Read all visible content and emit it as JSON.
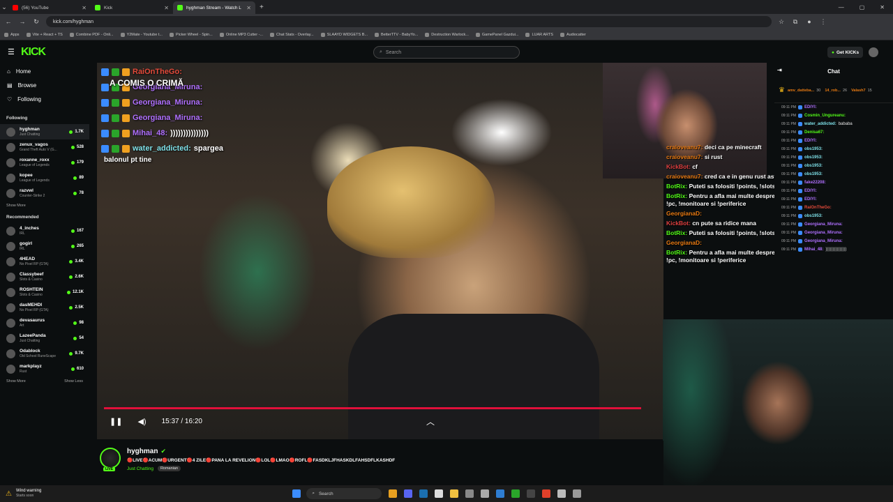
{
  "tabs": [
    {
      "title": "(56) YouTube",
      "icon": "youtube-icon",
      "color": "#ff0000",
      "active": false
    },
    {
      "title": "Kick",
      "icon": "kick-icon",
      "color": "#53fc18",
      "active": false
    },
    {
      "title": "hyghman Stream - Watch L",
      "icon": "kick-icon",
      "color": "#53fc18",
      "active": true
    }
  ],
  "address": "kick.com/hyghman",
  "bookmarks": [
    "Apps",
    "Vite + React + TS",
    "Combine PDF - Onli...",
    "Y2Mate - Youtube t...",
    "Picker Wheel - Spin...",
    "Online MP3 Cutter -...",
    "Chat Stats - Overlay...",
    "SLAAYD WIDGETS B...",
    "BetterTTV - BabyYo...",
    "Destruction Warlock...",
    "GamePanel Gazdui...",
    "LUAR ARTS",
    "Audiocatter"
  ],
  "header": {
    "logo": "KICK",
    "search_placeholder": "Search",
    "get_kicks": "Get KICKs"
  },
  "nav": {
    "home": "Home",
    "browse": "Browse",
    "following": "Following"
  },
  "sidebar": {
    "following_title": "Following",
    "following": [
      {
        "name": "hyghman",
        "category": "Just Chatting",
        "viewers": "1.7K"
      },
      {
        "name": "zenux_vagos",
        "category": "Grand Theft Auto V (G...",
        "viewers": "528"
      },
      {
        "name": "roxanne_roxx",
        "category": "League of Legends",
        "viewers": "179"
      },
      {
        "name": "kopee",
        "category": "League of Legends",
        "viewers": "89"
      },
      {
        "name": "razvwl",
        "category": "Counter-Strike 2",
        "viewers": "78"
      }
    ],
    "show_more": "Show More",
    "recommended_title": "Recommended",
    "recommended": [
      {
        "name": "4_inches",
        "category": "IRL",
        "viewers": "167"
      },
      {
        "name": "gogirl",
        "category": "IRL",
        "viewers": "265"
      },
      {
        "name": "4HEAD",
        "category": "No Pixel RP (GTA)",
        "viewers": "3.4K"
      },
      {
        "name": "Classybeef",
        "category": "Slots & Casino",
        "viewers": "2.6K"
      },
      {
        "name": "ROSHTEIN",
        "category": "Slots & Casino",
        "viewers": "12.1K"
      },
      {
        "name": "dasMEHDI",
        "category": "No Pixel RP (GTA)",
        "viewers": "2.5K"
      },
      {
        "name": "devasaurus",
        "category": "Art",
        "viewers": "98"
      },
      {
        "name": "LazeePanda",
        "category": "Just Chatting",
        "viewers": "54"
      },
      {
        "name": "Odablock",
        "category": "Old School RuneScape",
        "viewers": "9.7K"
      },
      {
        "name": "markplayz",
        "category": "Rust",
        "viewers": "610"
      }
    ],
    "show_more2": "Show More",
    "show_less": "Show Less"
  },
  "video": {
    "time": "15:37 / 16:20",
    "progress_fraction": 0.96,
    "overlay_title": "A COMIS O CRIMĂ",
    "overlay_chat": [
      {
        "user": "RaiOnTheGo:",
        "text": "",
        "color": "#e34a3a"
      },
      {
        "user": "Georgiana_Miruna:",
        "text": "",
        "color": "#b070ff"
      },
      {
        "user": "Georgiana_Miruna:",
        "text": "",
        "color": "#b070ff"
      },
      {
        "user": "Georgiana_Miruna:",
        "text": "",
        "color": "#b070ff"
      },
      {
        "user": "Mihai_48:",
        "text": ")))))))))))))))",
        "color": "#b070ff"
      },
      {
        "user": "water_addicted:",
        "text": "spargea",
        "color": "#7ee0e8"
      }
    ],
    "overlay_last": "balonul pt tine"
  },
  "overlay_right": [
    {
      "user": "craioveanu7:",
      "text": "deci ca pe minecraft",
      "color": "#e87a12"
    },
    {
      "user": "craioveanu7:",
      "text": "si rust",
      "color": "#e87a12"
    },
    {
      "user": "KickBot:",
      "text": "cf",
      "color": "#e04040"
    },
    {
      "user": "craioveanu7:",
      "text": "cred ca e in genu rust asta faci baza te batoi lootezi",
      "color": "#e87a12"
    },
    {
      "user": "BotRix:",
      "text": "Puteti sa folositi !points, !slots, !roulette si !gamble in chat",
      "color": "#53fc18"
    },
    {
      "user": "BotRix:",
      "text": "Pentru a afla mai multe despre setup-ul meu folositi comenzile !pc, !monitoare si !periferice",
      "color": "#53fc18"
    },
    {
      "user": "GeorgianaD:",
      "text": "",
      "color": "#e87a12"
    },
    {
      "user": "KickBot:",
      "text": "cn pute sa ridice mana",
      "color": "#e04040"
    },
    {
      "user": "BotRix:",
      "text": "Puteti sa folositi !points, !slots, !roulette si !gamble in chat",
      "color": "#53fc18"
    },
    {
      "user": "GeorgianaD:",
      "text": "",
      "color": "#e87a12"
    },
    {
      "user": "BotRix:",
      "text": "Pentru a afla mai multe despre setup-ul meu folositi comenzile !pc, !monitoare si !periferice",
      "color": "#53fc18"
    }
  ],
  "chat": {
    "title": "Chat",
    "pinned": [
      {
        "user": "amv_datteba...",
        "value": "30"
      },
      {
        "user": "14_rob...",
        "value": "26"
      },
      {
        "user": "Valash7",
        "value": "15"
      }
    ],
    "messages": [
      {
        "time": "09:11 PM",
        "user": "EDIYI:",
        "color": "#b070ff",
        "text": ""
      },
      {
        "time": "09:11 PM",
        "user": "Cosmin_Ungureanu:",
        "color": "#53fc18",
        "text": ""
      },
      {
        "time": "09:11 PM",
        "user": "water_addicted:",
        "color": "#7ee0e8",
        "text": "bababa"
      },
      {
        "time": "09:11 PM",
        "user": "Denisa67:",
        "color": "#53fc18",
        "text": ""
      },
      {
        "time": "09:11 PM",
        "user": "EDIYI:",
        "color": "#b070ff",
        "text": ""
      },
      {
        "time": "09:11 PM",
        "user": "obs1953:",
        "color": "#7ee0e8",
        "text": ""
      },
      {
        "time": "09:11 PM",
        "user": "obs1953:",
        "color": "#7ee0e8",
        "text": ""
      },
      {
        "time": "09:11 PM",
        "user": "obs1953:",
        "color": "#7ee0e8",
        "text": ""
      },
      {
        "time": "09:11 PM",
        "user": "obs1953:",
        "color": "#7ee0e8",
        "text": ""
      },
      {
        "time": "09:11 PM",
        "user": "fake22208:",
        "color": "#b070ff",
        "text": ""
      },
      {
        "time": "09:11 PM",
        "user": "EDIYI:",
        "color": "#b070ff",
        "text": ""
      },
      {
        "time": "09:11 PM",
        "user": "EDIYI:",
        "color": "#b070ff",
        "text": ""
      },
      {
        "time": "09:11 PM",
        "user": "RaiOnTheGo:",
        "color": "#e34a3a",
        "text": ""
      },
      {
        "time": "09:11 PM",
        "user": "obs1953:",
        "color": "#7ee0e8",
        "text": ""
      },
      {
        "time": "09:11 PM",
        "user": "Georgiana_Miruna:",
        "color": "#b070ff",
        "text": ""
      },
      {
        "time": "09:11 PM",
        "user": "Georgiana_Miruna:",
        "color": "#b070ff",
        "text": ""
      },
      {
        "time": "09:11 PM",
        "user": "Georgiana_Miruna:",
        "color": "#b070ff",
        "text": ""
      },
      {
        "time": "09:11 PM",
        "user": "Mihai_48:",
        "color": "#b070ff",
        "text": ")))))))))))))))"
      }
    ]
  },
  "stream": {
    "name": "hyghman",
    "title": "🔴LIVE🔴ACUM🔴URGENT🔴4 ZILE🔴PANA LA REVELION🔴LOL🔴LMAO🔴ROFL🔴FASDKLJFHASKDLFAHSDFLKASHDF",
    "category": "Just Chatting",
    "tag": "Romanian",
    "live_badge": "LIVE"
  },
  "taskbar": {
    "weather_title": "Wind warning",
    "weather_sub": "Starts soon",
    "search": "Search"
  }
}
